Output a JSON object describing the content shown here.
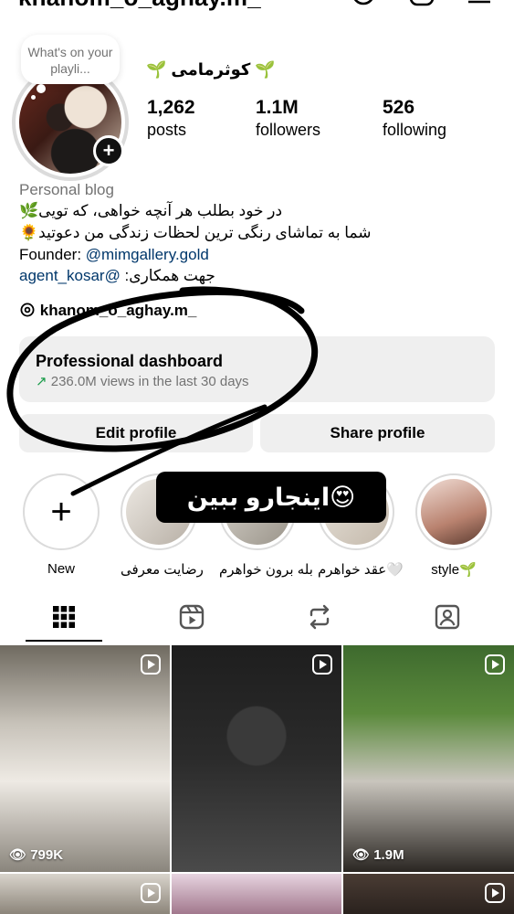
{
  "header": {
    "username": "khanom_o_aghay.m_",
    "chevron": "˅"
  },
  "profile": {
    "note": "What's on your playli...",
    "display_name": "🌱 کوثرمامی 🌱",
    "stats": [
      {
        "value": "1,262",
        "label": "posts"
      },
      {
        "value": "1.1M",
        "label": "followers"
      },
      {
        "value": "526",
        "label": "following"
      }
    ],
    "category": "Personal blog",
    "bio": {
      "line1": "در خود بطلب هر آنچه خواهی، که تویی🌿",
      "line2": "شما به تماشای رنگی ترین لحظات زندگی من دعوتید🌻",
      "founder_label": "Founder: ",
      "founder_link": "@mimgallery.gold",
      "collab_link": "agent_kosar@",
      "collab_text": " :جهت همکاری"
    },
    "threads_handle": "khanom_o_aghay.m_"
  },
  "dashboard": {
    "title": "Professional dashboard",
    "arrow": "↗",
    "subtitle": "236.0M views in the last 30 days"
  },
  "buttons": {
    "edit": "Edit profile",
    "share": "Share profile"
  },
  "highlights": [
    {
      "label": "New"
    },
    {
      "label": "رضایت معرفی"
    },
    {
      "label": "بله برون خواهرم"
    },
    {
      "label": "عقد خواهرم🤍"
    },
    {
      "label": "style🌱"
    }
  ],
  "sticker": {
    "text": "اینجارو ببین😍"
  },
  "tabs": [
    "grid",
    "reels",
    "reposts",
    "tagged"
  ],
  "posts": [
    {
      "views": "799K"
    },
    {
      "views": ""
    },
    {
      "views": "1.9M"
    }
  ],
  "colors": {
    "accent_link": "#00376b",
    "notification": "#ff3040",
    "button_bg": "#efefef"
  }
}
